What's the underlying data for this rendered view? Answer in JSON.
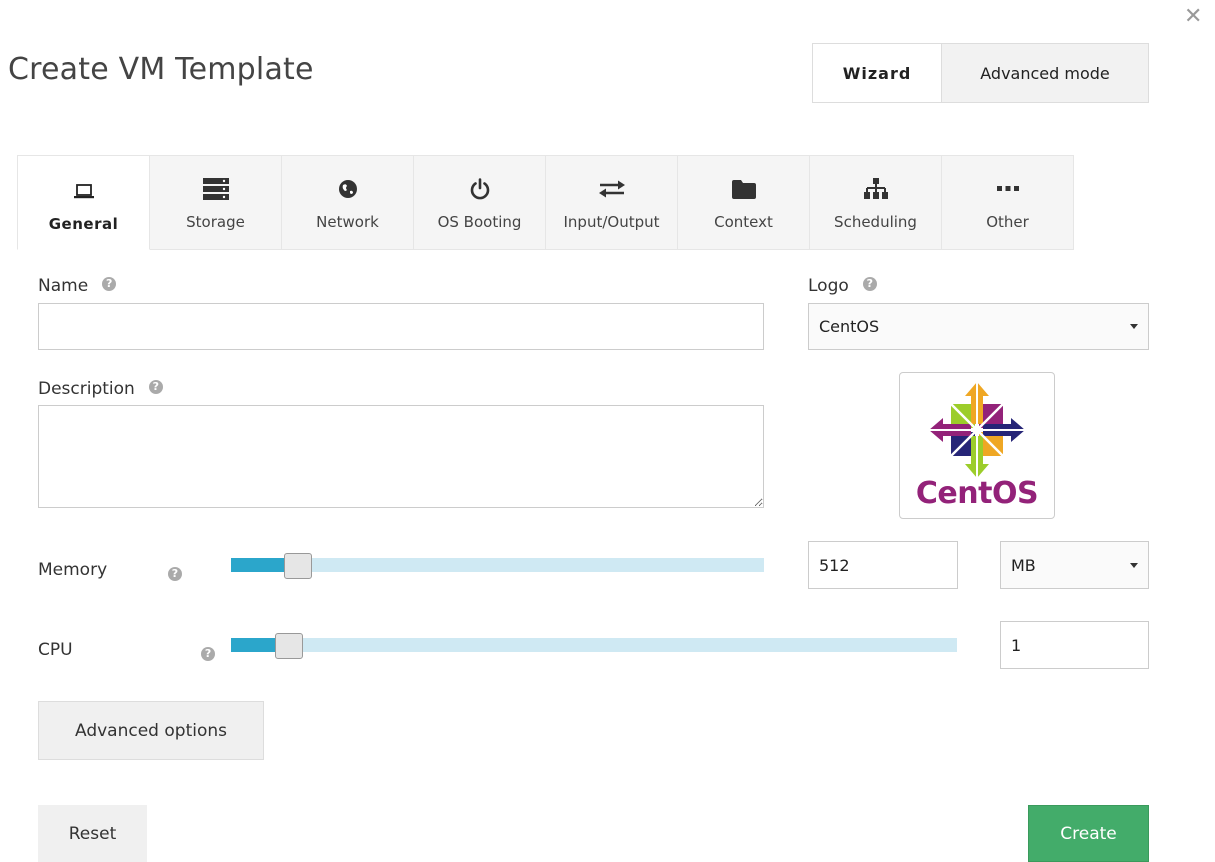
{
  "dialog": {
    "title": "Create VM Template",
    "close_icon": "close-icon"
  },
  "modes": {
    "wizard_label": "Wizard",
    "advanced_label": "Advanced mode",
    "active": "Wizard"
  },
  "tabs": [
    {
      "label": "General",
      "icon": "laptop-icon",
      "active": true
    },
    {
      "label": "Storage",
      "icon": "server-icon"
    },
    {
      "label": "Network",
      "icon": "globe-icon"
    },
    {
      "label": "OS Booting",
      "icon": "power-icon"
    },
    {
      "label": "Input/Output",
      "icon": "arrows-exchange-icon"
    },
    {
      "label": "Context",
      "icon": "folder-icon"
    },
    {
      "label": "Scheduling",
      "icon": "sitemap-icon"
    },
    {
      "label": "Other",
      "icon": "ellipsis-icon"
    }
  ],
  "form": {
    "name_label": "Name",
    "name_value": "",
    "description_label": "Description",
    "description_value": "",
    "logo_label": "Logo",
    "logo_value": "CentOS",
    "logo_image_text": "CentOS",
    "memory_label": "Memory",
    "memory_value": "512",
    "memory_unit": "MB",
    "memory_slider_fraction": 0.1,
    "cpu_label": "CPU",
    "cpu_value": "1",
    "cpu_slider_fraction": 0.06,
    "advanced_options_label": "Advanced options"
  },
  "footer": {
    "reset_label": "Reset",
    "create_label": "Create"
  },
  "colors": {
    "slider_fill": "#2ba6cb",
    "slider_track": "#cfe9f3",
    "create_button": "#43ac6a",
    "logo_purple": "#932279"
  }
}
